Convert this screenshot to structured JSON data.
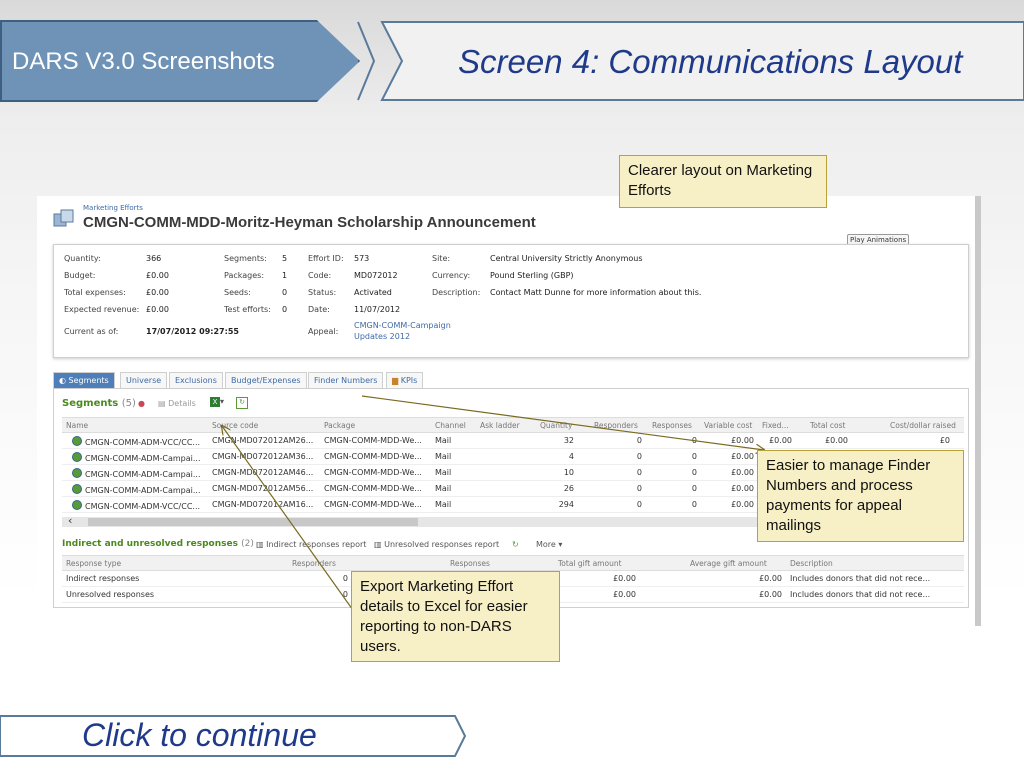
{
  "header": {
    "left_title": "DARS V3.0 Screenshots",
    "right_title": "Screen 4: Communications Layout"
  },
  "effort": {
    "breadcrumb": "Marketing Efforts",
    "title": "CMGN-COMM-MDD-Moritz-Heyman Scholarship Announcement",
    "play_button": "Play Animations",
    "fields": {
      "quantity_label": "Quantity:",
      "quantity": "366",
      "budget_label": "Budget:",
      "budget": "£0.00",
      "total_expenses_label": "Total expenses:",
      "total_expenses": "£0.00",
      "expected_revenue_label": "Expected revenue:",
      "expected_revenue": "£0.00",
      "current_as_of_label": "Current as of:",
      "current_as_of": "17/07/2012 09:27:55",
      "segments_label": "Segments:",
      "segments": "5",
      "packages_label": "Packages:",
      "packages": "1",
      "seeds_label": "Seeds:",
      "seeds": "0",
      "test_efforts_label": "Test efforts:",
      "test_efforts": "0",
      "effort_id_label": "Effort ID:",
      "effort_id": "573",
      "code_label": "Code:",
      "code": "MD072012",
      "status_label": "Status:",
      "status": "Activated",
      "date_label": "Date:",
      "date": "11/07/2012",
      "appeal_label": "Appeal:",
      "appeal_line1": "CMGN-COMM-Campaign",
      "appeal_line2": "Updates 2012",
      "site_label": "Site:",
      "site": "Central University Strictly Anonymous",
      "currency_label": "Currency:",
      "currency": "Pound Sterling (GBP)",
      "description_label": "Description:",
      "description": "Contact Matt Dunne for more information about this."
    }
  },
  "tabs": [
    "Segments",
    "Universe",
    "Exclusions",
    "Budget/Expenses",
    "Finder Numbers",
    "KPIs"
  ],
  "segments": {
    "title": "Segments",
    "count": "(5)",
    "details_label": "Details",
    "columns": [
      "Name",
      "Source code",
      "Package",
      "Channel",
      "Ask ladder",
      "Quantity",
      "Responders",
      "Responses",
      "Variable cost",
      "Fixed...",
      "Total cost",
      "Cost/dollar raised"
    ],
    "rows": [
      {
        "name": "CMGN-COMM-ADM-VCC/CC...",
        "source": "CMGN-MD072012AM26...",
        "package": "CMGN-COMM-MDD-We...",
        "channel": "Mail",
        "quantity": "32",
        "responders": "0",
        "responses": "0",
        "variable": "£0.00",
        "fixed": "£0.00",
        "total": "£0.00",
        "cpd": "£0"
      },
      {
        "name": "CMGN-COMM-ADM-Campai...",
        "source": "CMGN-MD072012AM36...",
        "package": "CMGN-COMM-MDD-We...",
        "channel": "Mail",
        "quantity": "4",
        "responders": "0",
        "responses": "0",
        "variable": "£0.00"
      },
      {
        "name": "CMGN-COMM-ADM-Campai...",
        "source": "CMGN-MD072012AM46...",
        "package": "CMGN-COMM-MDD-We...",
        "channel": "Mail",
        "quantity": "10",
        "responders": "0",
        "responses": "0",
        "variable": "£0.00"
      },
      {
        "name": "CMGN-COMM-ADM-Campai...",
        "source": "CMGN-MD072012AM56...",
        "package": "CMGN-COMM-MDD-We...",
        "channel": "Mail",
        "quantity": "26",
        "responders": "0",
        "responses": "0",
        "variable": "£0.00"
      },
      {
        "name": "CMGN-COMM-ADM-VCC/CC...",
        "source": "CMGN-MD072012AM16...",
        "package": "CMGN-COMM-MDD-We...",
        "channel": "Mail",
        "quantity": "294",
        "responders": "0",
        "responses": "0",
        "variable": "£0.00"
      }
    ]
  },
  "indirect": {
    "title": "Indirect and unresolved responses",
    "count": "(2)",
    "tool1": "Indirect responses report",
    "tool2": "Unresolved responses report",
    "more": "More",
    "columns": [
      "Response type",
      "Responders",
      "Responses",
      "Total gift amount",
      "Average gift amount",
      "Description"
    ],
    "rows": [
      {
        "type": "Indirect responses",
        "responders": "0",
        "total": "£0.00",
        "average": "£0.00",
        "description": "Includes donors that did not rece..."
      },
      {
        "type": "Unresolved responses",
        "responders": "0",
        "total": "£0.00",
        "average": "£0.00",
        "description": "Includes donors that did not rece..."
      }
    ]
  },
  "callouts": {
    "layout": "Clearer layout on Marketing Efforts",
    "finder": "Easier to manage Finder Numbers and process payments for appeal mailings",
    "export": "Export Marketing Effort details to Excel for easier reporting to non-DARS users."
  },
  "footer": {
    "continue": "Click to continue"
  }
}
